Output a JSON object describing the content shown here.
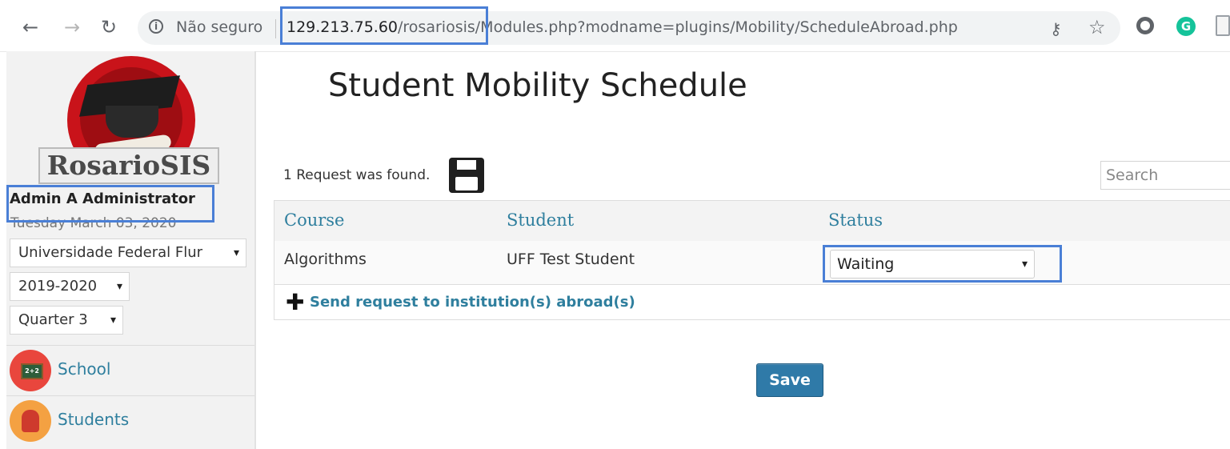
{
  "browser": {
    "back_icon": "arrow-left-icon",
    "forward_icon": "arrow-right-icon",
    "reload_icon": "reload-icon",
    "security_label": "Não seguro",
    "url_host": "129.213.75.60",
    "url_path": "/rosariosis/Modules.php?modname=plugins/Mobility/ScheduleAbroad.php",
    "grammarly_label": "G"
  },
  "sidebar": {
    "logo_text": "RosarioSIS",
    "user_name": "Admin A Administrator",
    "date": "Tuesday March 03, 2020",
    "school_select": "Universidade Federal Flur",
    "year_select": "2019-2020",
    "quarter_select": "Quarter 3",
    "select_arrow": "▾",
    "menu": [
      {
        "label": "School",
        "icon": "school-icon"
      },
      {
        "label": "Students",
        "icon": "students-icon"
      }
    ]
  },
  "main": {
    "title": "Student Mobility Schedule",
    "found_text": "1 Request was found.",
    "search_placeholder": "Search",
    "columns": [
      "Course",
      "Student",
      "Status"
    ],
    "rows": [
      {
        "course": "Algorithms",
        "student": "UFF Test Student",
        "status": "Waiting"
      }
    ],
    "add_link": "Send request to institution(s) abroad(s)",
    "add_symbol": "✚",
    "save_button": "Save"
  },
  "colors": {
    "accent": "#2f7f9e",
    "highlight_box": "#4a7fd6",
    "save_button": "#2f7aa8"
  }
}
